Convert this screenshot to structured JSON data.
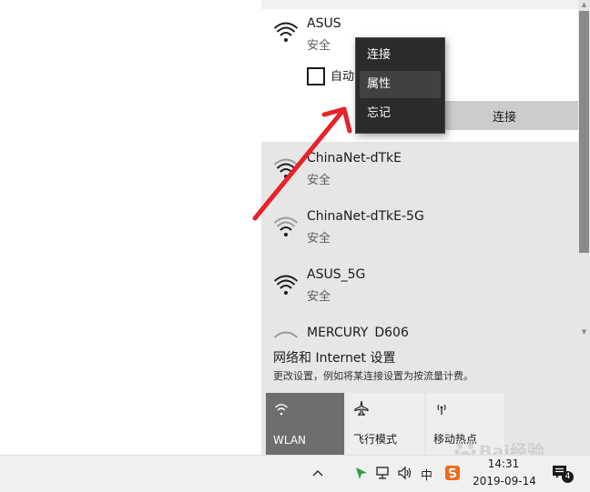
{
  "networks": {
    "selected": {
      "name": "ASUS",
      "status": "安全",
      "autoconnect_label": "自动",
      "connect_label": "连接"
    },
    "list": [
      {
        "name": "ChinaNet-dTkE",
        "status": "安全"
      },
      {
        "name": "ChinaNet-dTkE-5G",
        "status": "安全"
      },
      {
        "name": "ASUS_5G",
        "status": "安全"
      },
      {
        "name": "MERCURY_D606",
        "status": ""
      }
    ]
  },
  "context_menu": {
    "items": [
      "连接",
      "属性",
      "忘记"
    ],
    "highlighted": "属性"
  },
  "settings": {
    "title": "网络和 Internet 设置",
    "description": "更改设置，例如将某连接设置为按流量计费。"
  },
  "quick_actions": [
    {
      "label": "WLAN",
      "icon": "wifi-icon",
      "active": true
    },
    {
      "label": "飞行模式",
      "icon": "airplane-icon",
      "active": false
    },
    {
      "label": "移动热点",
      "icon": "hotspot-icon",
      "active": false
    }
  ],
  "taskbar": {
    "time": "14:31",
    "date": "2019-09-14",
    "ime": "中",
    "notification_count": "4"
  },
  "watermark": {
    "text": "Bai经验"
  },
  "colors": {
    "arrow": "#e8212a",
    "menu_bg": "#2b2b2b",
    "wlan_active": "#6e6e6e"
  }
}
